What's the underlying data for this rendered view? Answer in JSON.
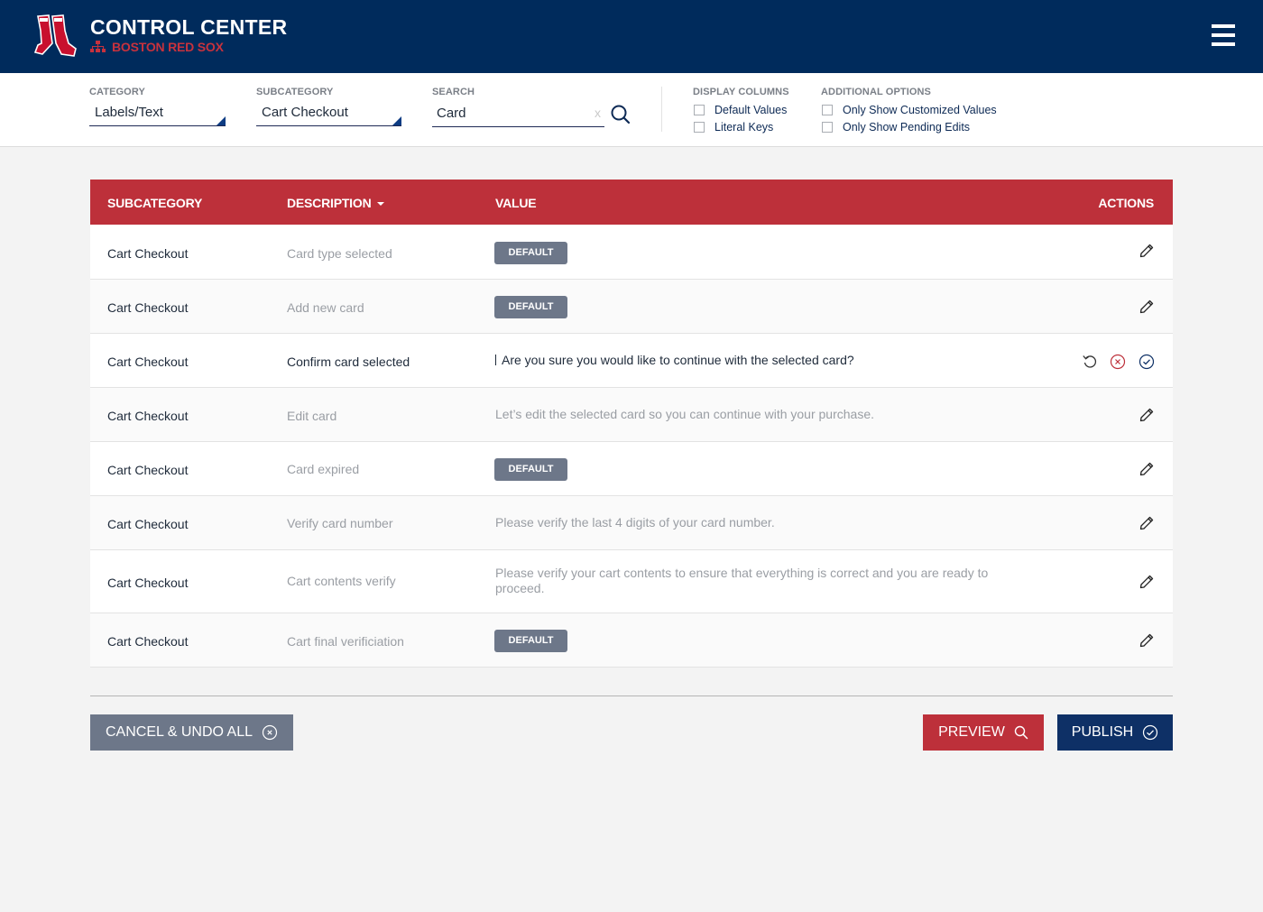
{
  "header": {
    "title": "CONTROL CENTER",
    "team": "BOSTON RED SOX"
  },
  "filters": {
    "category_label": "CATEGORY",
    "category_value": "Labels/Text",
    "subcategory_label": "SUBCATEGORY",
    "subcategory_value": "Cart Checkout",
    "search_label": "SEARCH",
    "search_value": "Card",
    "clear_label": "x",
    "display_columns_label": "DISPLAY COLUMNS",
    "display_columns": [
      "Default Values",
      "Literal Keys"
    ],
    "additional_options_label": "ADDITIONAL OPTIONS",
    "additional_options": [
      "Only Show Customized Values",
      "Only Show Pending Edits"
    ]
  },
  "table": {
    "headers": {
      "subcategory": "SUBCATEGORY",
      "description": "DESCRIPTION",
      "value": "VALUE",
      "actions": "ACTIONS"
    },
    "rows": [
      {
        "subcategory": "Cart Checkout",
        "description": "Card type selected",
        "value": "DEFAULT"
      },
      {
        "subcategory": "Cart Checkout",
        "description": "Add new card",
        "value": "DEFAULT"
      },
      {
        "subcategory": "Cart Checkout",
        "description": "Confirm card selected",
        "value": "Are you sure you would like to continue with the selected card?"
      },
      {
        "subcategory": "Cart Checkout",
        "description": "Edit card",
        "value": "Let’s edit the selected card so you can continue with your purchase."
      },
      {
        "subcategory": "Cart Checkout",
        "description": "Card expired",
        "value": "DEFAULT"
      },
      {
        "subcategory": "Cart Checkout",
        "description": "Verify card number",
        "value": "Please verify the last 4 digits of your card number."
      },
      {
        "subcategory": "Cart Checkout",
        "description": "Cart contents verify",
        "value": "Please verify your cart contents to ensure that everything is correct and you are ready to proceed."
      },
      {
        "subcategory": "Cart Checkout",
        "description": "Cart final verificiation",
        "value": "DEFAULT"
      }
    ]
  },
  "buttons": {
    "cancel": "CANCEL & UNDO ALL",
    "preview": "PREVIEW",
    "publish": "PUBLISH"
  },
  "colors": {
    "navy": "#002b5c",
    "red": "#bd303a",
    "badge_gray": "#6d7789",
    "publish_navy": "#0e3066"
  }
}
